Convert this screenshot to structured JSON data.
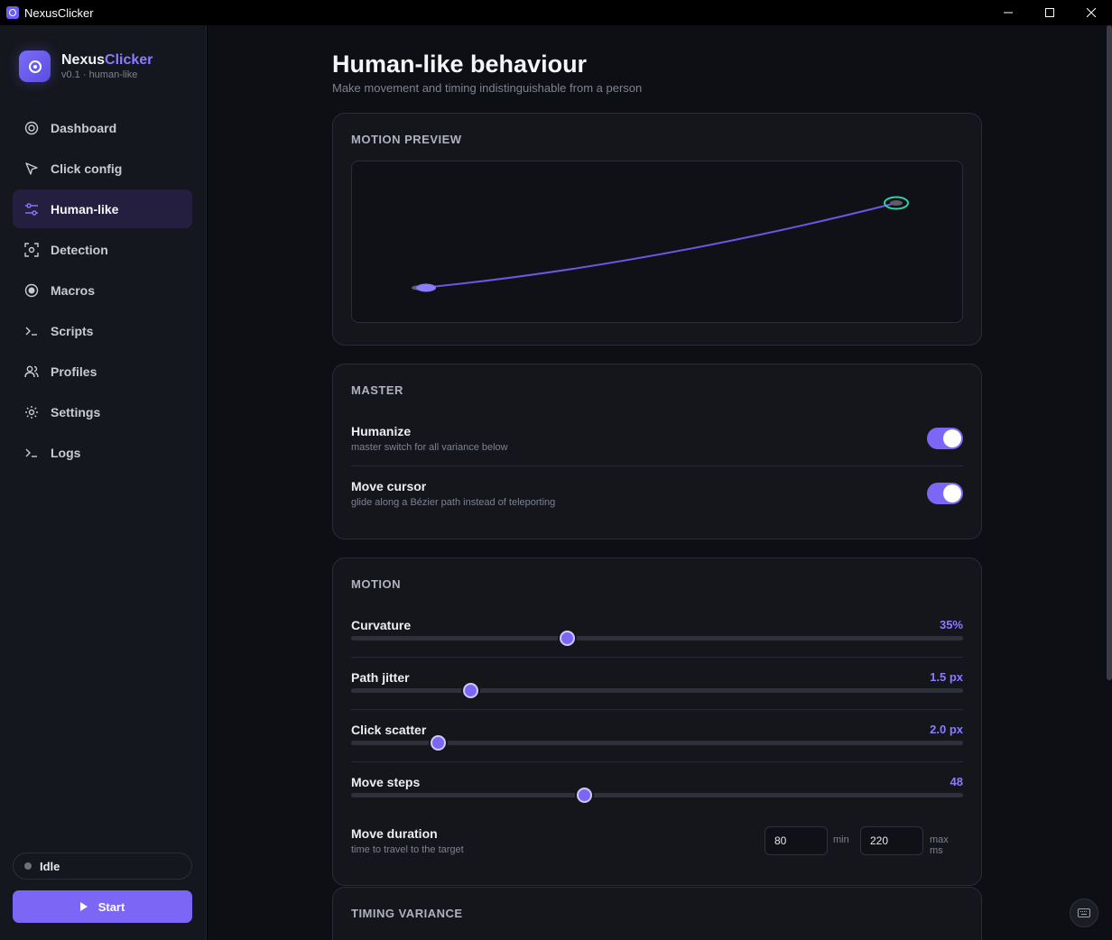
{
  "window": {
    "title": "NexusClicker"
  },
  "brand": {
    "name_part1": "Nexus",
    "name_part2": "Clicker",
    "subtitle": "v0.1 · human-like"
  },
  "nav": [
    {
      "label": "Dashboard",
      "icon": "target-icon"
    },
    {
      "label": "Click config",
      "icon": "cursor-icon"
    },
    {
      "label": "Human-like",
      "icon": "sliders-icon",
      "active": true
    },
    {
      "label": "Detection",
      "icon": "scan-icon"
    },
    {
      "label": "Macros",
      "icon": "record-icon"
    },
    {
      "label": "Scripts",
      "icon": "terminal-icon"
    },
    {
      "label": "Profiles",
      "icon": "users-icon"
    },
    {
      "label": "Settings",
      "icon": "gear-icon"
    },
    {
      "label": "Logs",
      "icon": "terminal-icon"
    }
  ],
  "status": {
    "label": "Idle"
  },
  "start_button": {
    "label": "Start"
  },
  "page": {
    "title": "Human-like behaviour",
    "subtitle": "Make movement and timing indistinguishable from a person"
  },
  "preview": {
    "title": "MOTION PREVIEW"
  },
  "master": {
    "title": "MASTER",
    "humanize": {
      "label": "Humanize",
      "help": "master switch for all variance below",
      "on": true
    },
    "move_cursor": {
      "label": "Move cursor",
      "help": "glide along a Bézier path instead of teleporting",
      "on": true
    }
  },
  "motion": {
    "title": "MOTION",
    "sliders": [
      {
        "label": "Curvature",
        "value": "35%",
        "fraction": 0.352
      },
      {
        "label": "Path jitter",
        "value": "1.5 px",
        "fraction": 0.194
      },
      {
        "label": "Click scatter",
        "value": "2.0 px",
        "fraction": 0.142
      },
      {
        "label": "Move steps",
        "value": "48",
        "fraction": 0.381
      }
    ],
    "duration": {
      "label": "Move duration",
      "help": "time to travel to the target",
      "min": "80",
      "min_unit": "min",
      "max": "220",
      "max_unit": "max ms"
    }
  },
  "timing": {
    "title": "TIMING VARIANCE"
  },
  "colors": {
    "accent": "#7b66f6",
    "accent_text": "#8b7bff",
    "target": "#2fd0a4"
  }
}
